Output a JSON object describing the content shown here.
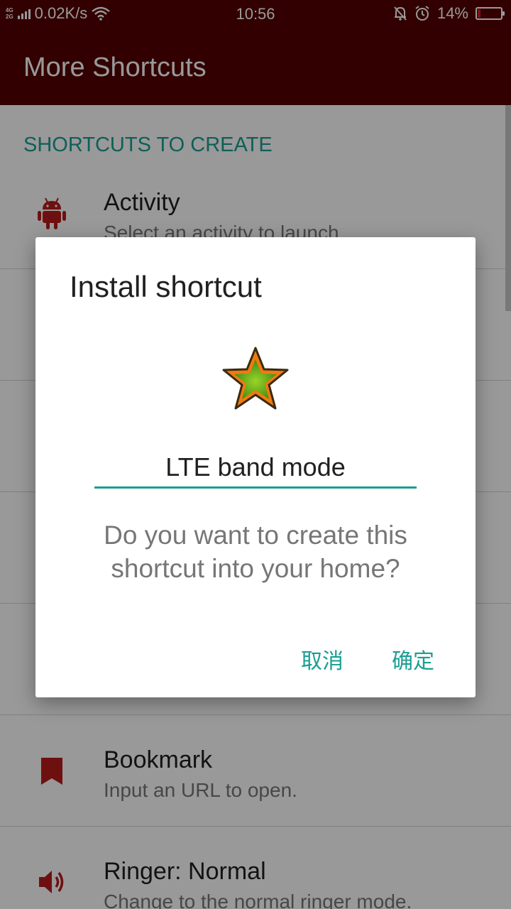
{
  "status_bar": {
    "network_top": "4G",
    "network_bottom": "2G",
    "speed": "0.02K/s",
    "time": "10:56",
    "battery_percent": "14%",
    "battery_level": 0.14,
    "icons": [
      "signal-icon",
      "wifi-icon",
      "bell-muted-icon",
      "alarm-icon",
      "battery-icon"
    ]
  },
  "app_bar": {
    "title": "More Shortcuts"
  },
  "list": {
    "section_header": "SHORTCUTS TO CREATE",
    "items": [
      {
        "title": "Activity",
        "subtitle": "Select an activity to launch",
        "icon": "android-icon"
      },
      {
        "title": "Bookmark",
        "subtitle": "Input an URL to open.",
        "icon": "bookmark-icon"
      },
      {
        "title": "Ringer: Normal",
        "subtitle": "Change to the normal ringer mode.",
        "icon": "speaker-icon"
      }
    ]
  },
  "dialog": {
    "title": "Install shortcut",
    "icon": "star-icon",
    "name_value": "LTE band mode",
    "message": "Do you want to create this shortcut into your home?",
    "cancel_label": "取消",
    "ok_label": "确定"
  },
  "colors": {
    "primary_dark": "#540000",
    "accent": "#1a9e93",
    "icon_red": "#b71c1c"
  }
}
